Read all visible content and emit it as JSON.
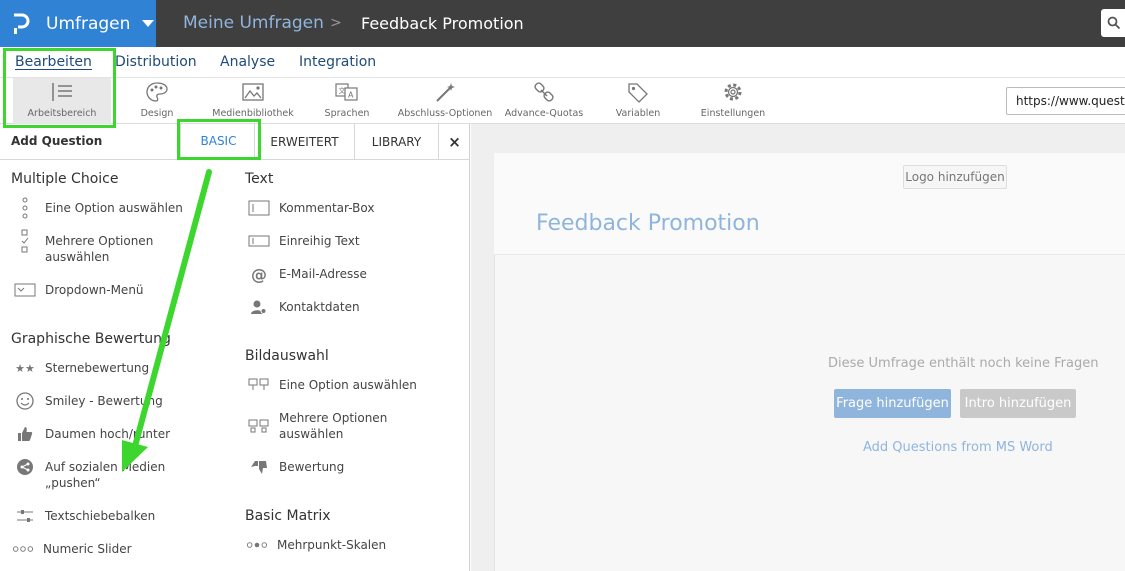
{
  "header": {
    "app_name": "Umfragen",
    "breadcrumb_parent": "Meine Umfragen",
    "breadcrumb_separator": ">",
    "breadcrumb_current": "Feedback Promotion"
  },
  "menu": {
    "items": [
      "Bearbeiten",
      "Distribution",
      "Analyse",
      "Integration"
    ],
    "active": "Bearbeiten"
  },
  "toolbar": {
    "items": [
      {
        "label": "Arbeitsbereich",
        "icon": "workspace-icon"
      },
      {
        "label": "Design",
        "icon": "palette-icon"
      },
      {
        "label": "Medienbibliothek",
        "icon": "image-icon"
      },
      {
        "label": "Sprachen",
        "icon": "translate-icon"
      },
      {
        "label": "Abschluss-Optionen",
        "icon": "magic-wand-icon"
      },
      {
        "label": "Advance-Quotas",
        "icon": "link-icon"
      },
      {
        "label": "Variablen",
        "icon": "tag-icon"
      },
      {
        "label": "Einstellungen",
        "icon": "gear-icon"
      }
    ],
    "url_value": "https://www.questionpro.com"
  },
  "panel": {
    "title": "Add Question",
    "tabs": [
      "BASIC",
      "ERWEITERT",
      "LIBRARY"
    ],
    "active_tab": "BASIC",
    "close": "×"
  },
  "sections": {
    "multiple_choice": {
      "title": "Multiple Choice",
      "items": [
        "Eine Option auswählen",
        "Mehrere Optionen auswählen",
        "Dropdown-Menü"
      ]
    },
    "graphic_rating": {
      "title": "Graphische Bewertung",
      "items": [
        "Sternebewertung",
        "Smiley - Bewertung",
        "Daumen hoch/runter",
        "Auf sozialen Medien „pushen“",
        "Textschiebebalken",
        "Numeric Slider"
      ]
    },
    "text": {
      "title": "Text",
      "items": [
        "Kommentar-Box",
        "Einreihig Text",
        "E-Mail-Adresse",
        "Kontaktdaten"
      ]
    },
    "image_choice": {
      "title": "Bildauswahl",
      "items": [
        "Eine Option auswählen",
        "Mehrere Optionen auswählen",
        "Bewertung"
      ]
    },
    "basic_matrix": {
      "title": "Basic Matrix",
      "items": [
        "Mehrpunkt-Skalen"
      ]
    }
  },
  "canvas": {
    "logo_button": "Logo hinzufügen",
    "survey_title": "Feedback Promotion",
    "empty_message": "Diese Umfrage enthält noch keine Fragen",
    "add_question": "Frage hinzufügen",
    "add_intro": "Intro hinzufügen",
    "ms_word_link": "Add Questions from MS Word"
  },
  "colors": {
    "brand": "#2f82d4",
    "topbar": "#3f3f3f",
    "highlight": "#3dd62f",
    "accent_light": "#8fb5dd"
  }
}
